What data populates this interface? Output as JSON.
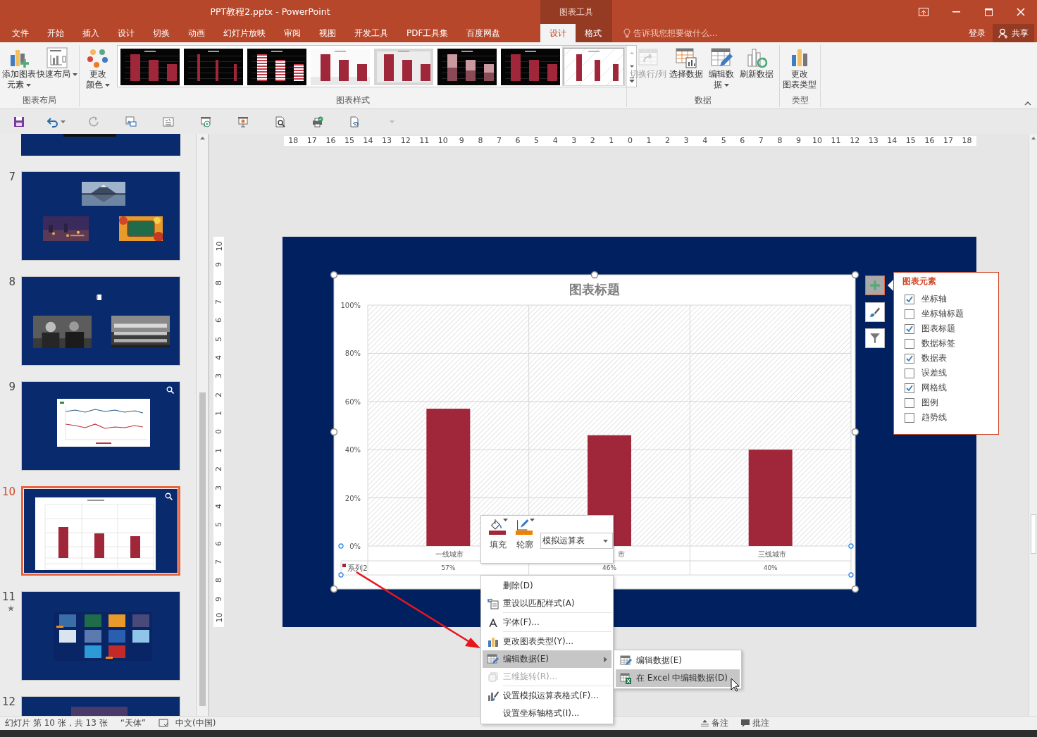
{
  "window": {
    "title": "PPT教程2.pptx - PowerPoint",
    "context_group": "图表工具"
  },
  "tabs": [
    {
      "label": "文件",
      "selected": false,
      "kind": "main"
    },
    {
      "label": "开始",
      "selected": false,
      "kind": "main"
    },
    {
      "label": "插入",
      "selected": false,
      "kind": "main"
    },
    {
      "label": "设计",
      "selected": false,
      "kind": "main"
    },
    {
      "label": "切换",
      "selected": false,
      "kind": "main"
    },
    {
      "label": "动画",
      "selected": false,
      "kind": "main"
    },
    {
      "label": "幻灯片放映",
      "selected": false,
      "kind": "main"
    },
    {
      "label": "审阅",
      "selected": false,
      "kind": "main"
    },
    {
      "label": "视图",
      "selected": false,
      "kind": "main"
    },
    {
      "label": "开发工具",
      "selected": false,
      "kind": "main"
    },
    {
      "label": "PDF工具集",
      "selected": false,
      "kind": "main"
    },
    {
      "label": "百度网盘",
      "selected": false,
      "kind": "main"
    },
    {
      "label": "设计",
      "selected": true,
      "kind": "context"
    },
    {
      "label": "格式",
      "selected": false,
      "kind": "context"
    }
  ],
  "tell_me": {
    "placeholder": "告诉我您想要做什么..."
  },
  "account": {
    "sign_in": "登录",
    "share": "共享"
  },
  "ribbon": {
    "groups": [
      {
        "label": "图表布局",
        "buttons": [
          {
            "kind": "add-element",
            "lines": [
              "添加图表",
              "元素"
            ],
            "dropdown": true,
            "disabled": false
          },
          {
            "kind": "quick-layout",
            "lines": [
              "快速布局"
            ],
            "dropdown": true,
            "disabled": false
          }
        ]
      },
      {
        "label": "图表样式",
        "buttons": [
          {
            "kind": "colors",
            "lines": [
              "更改",
              "颜色"
            ],
            "dropdown": true,
            "disabled": false
          }
        ],
        "styles": [
          {
            "kind": "dark",
            "selected": false
          },
          {
            "kind": "dark-thin",
            "selected": false
          },
          {
            "kind": "striped",
            "selected": false
          },
          {
            "kind": "light",
            "selected": false
          },
          {
            "kind": "silver",
            "selected": false
          },
          {
            "kind": "fade",
            "selected": false
          },
          {
            "kind": "dark",
            "selected": false
          },
          {
            "kind": "pattern",
            "selected": true
          }
        ]
      },
      {
        "label": "数据",
        "buttons": [
          {
            "kind": "switch",
            "lines": [
              "切换行/列"
            ],
            "dropdown": false,
            "disabled": true
          },
          {
            "kind": "select",
            "lines": [
              "选择数据"
            ],
            "dropdown": false,
            "disabled": false
          },
          {
            "kind": "edit",
            "lines": [
              "编辑数",
              "据"
            ],
            "dropdown": true,
            "disabled": false
          },
          {
            "kind": "refresh",
            "lines": [
              "刷新数据"
            ],
            "dropdown": false,
            "disabled": false
          }
        ]
      },
      {
        "label": "类型",
        "buttons": [
          {
            "kind": "change-type",
            "lines": [
              "更改",
              "图表类型"
            ],
            "dropdown": false,
            "disabled": false
          }
        ]
      }
    ]
  },
  "slides": [
    {
      "number": "7",
      "kind": "photos3",
      "selected": false,
      "starred": false,
      "zoom": false
    },
    {
      "number": "8",
      "kind": "photos2",
      "selected": false,
      "starred": false,
      "zoom": false
    },
    {
      "number": "9",
      "kind": "line-chart",
      "selected": false,
      "starred": false,
      "zoom": true
    },
    {
      "number": "10",
      "kind": "bar-chart",
      "selected": true,
      "starred": false,
      "zoom": true
    },
    {
      "number": "11",
      "kind": "collage",
      "selected": false,
      "starred": true,
      "zoom": false
    },
    {
      "number": "12",
      "kind": "partial",
      "selected": false,
      "starred": false,
      "zoom": false
    }
  ],
  "ruler": {
    "horizontal": [
      "18",
      "17",
      "16",
      "15",
      "14",
      "13",
      "12",
      "11",
      "10",
      "9",
      "8",
      "7",
      "6",
      "5",
      "4",
      "3",
      "2",
      "1",
      "0",
      "1",
      "2",
      "3",
      "4",
      "5",
      "6",
      "7",
      "8",
      "9",
      "10",
      "11",
      "12",
      "13",
      "14",
      "15",
      "16",
      "17",
      "18"
    ],
    "vertical": [
      "10",
      "9",
      "8",
      "7",
      "6",
      "5",
      "4",
      "3",
      "2",
      "1",
      "0",
      "1",
      "2",
      "3",
      "4",
      "5",
      "6",
      "7",
      "8",
      "9",
      "10"
    ]
  },
  "chart": {
    "chart_data": {
      "type": "bar",
      "title": "图表标题",
      "categories": [
        "一线城市",
        "市",
        "三线城市"
      ],
      "grid": true,
      "series": [
        {
          "name": "系列2",
          "color": "#a0263a",
          "values": [
            0.57,
            0.46,
            0.4
          ]
        }
      ],
      "ylim": [
        0,
        1
      ],
      "yticks": [
        {
          "value": 0,
          "label": "0%"
        },
        {
          "value": 0.2,
          "label": "20%"
        },
        {
          "value": 0.4,
          "label": "40%"
        },
        {
          "value": 0.6,
          "label": "60%"
        },
        {
          "value": 0.8,
          "label": "80%"
        },
        {
          "value": 1,
          "label": "100%"
        }
      ]
    },
    "table_values": [
      "57%",
      "46%",
      "40%"
    ]
  },
  "chart_tools": [
    {
      "kind": "elements",
      "selected": true
    },
    {
      "kind": "styles",
      "selected": false
    },
    {
      "kind": "filter",
      "selected": false
    }
  ],
  "elements_panel": {
    "title": "图表元素",
    "items": [
      {
        "label": "坐标轴",
        "checked": true
      },
      {
        "label": "坐标轴标题",
        "checked": false
      },
      {
        "label": "图表标题",
        "checked": true
      },
      {
        "label": "数据标签",
        "checked": false
      },
      {
        "label": "数据表",
        "checked": true
      },
      {
        "label": "误差线",
        "checked": false
      },
      {
        "label": "网格线",
        "checked": true
      },
      {
        "label": "图例",
        "checked": false
      },
      {
        "label": "趋势线",
        "checked": false
      }
    ]
  },
  "mini_toolbar": {
    "buttons": [
      {
        "label": "填充",
        "kind": "fill",
        "color": "#a0263a"
      },
      {
        "label": "轮廓",
        "kind": "outline",
        "color": "#f08000"
      }
    ],
    "dropdown": {
      "value": "模拟运算表"
    }
  },
  "context_menu": {
    "items": [
      {
        "label": "删除(D)",
        "kind": "none",
        "disabled": false,
        "highlighted": false,
        "submenu": false,
        "separator_after": false
      },
      {
        "label": "重设以匹配样式(A)",
        "kind": "reset",
        "disabled": false,
        "highlighted": false,
        "submenu": false,
        "separator_after": true
      },
      {
        "label": "字体(F)...",
        "kind": "font",
        "disabled": false,
        "highlighted": false,
        "submenu": false,
        "separator_after": true
      },
      {
        "label": "更改图表类型(Y)...",
        "kind": "chart-type",
        "disabled": false,
        "highlighted": false,
        "submenu": false,
        "separator_after": false
      },
      {
        "label": "编辑数据(E)",
        "kind": "edit",
        "disabled": false,
        "highlighted": true,
        "submenu": true,
        "separator_after": false
      },
      {
        "label": "三维旋转(R)...",
        "kind": "rotate",
        "disabled": true,
        "highlighted": false,
        "submenu": false,
        "separator_after": true
      },
      {
        "label": "设置模拟运算表格式(F)...",
        "kind": "format",
        "disabled": false,
        "highlighted": false,
        "submenu": false,
        "separator_after": false
      },
      {
        "label": "设置坐标轴格式(I)...",
        "kind": "none",
        "disabled": false,
        "highlighted": false,
        "submenu": false,
        "separator_after": false
      }
    ]
  },
  "submenu": {
    "items": [
      {
        "label": "编辑数据(E)",
        "kind": "edit",
        "highlighted": false
      },
      {
        "label": "在 Excel 中编辑数据(D)",
        "kind": "excel",
        "highlighted": true
      }
    ]
  },
  "status_bar": {
    "slide_info": "幻灯片 第 10 张，共 13 张",
    "theme": "“天体”",
    "language": "中文(中国)",
    "notes": "备注",
    "comments": "批注"
  }
}
